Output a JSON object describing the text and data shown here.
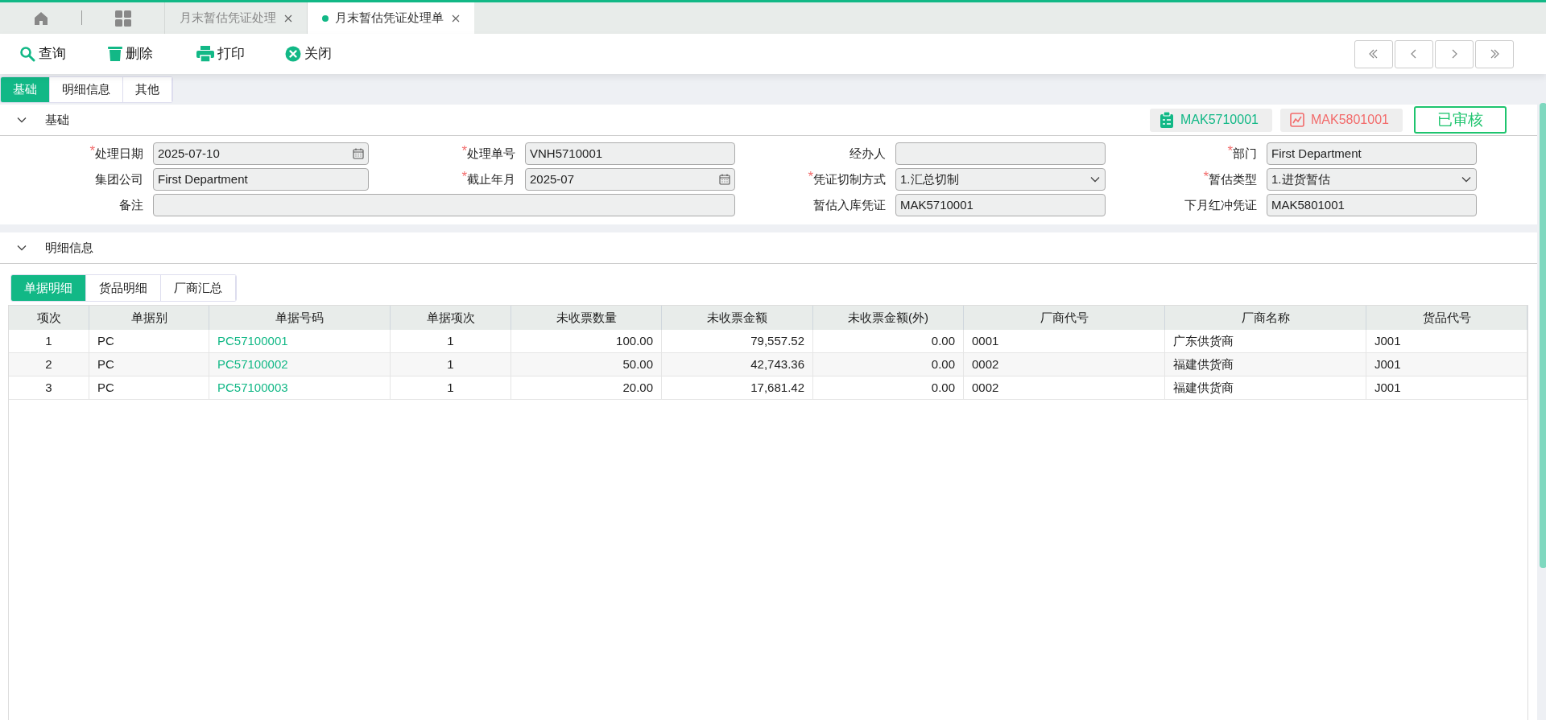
{
  "app_tabs": [
    {
      "kind": "home"
    },
    {
      "kind": "grid"
    },
    {
      "kind": "page",
      "label": "月末暂估凭证处理",
      "selected": false
    },
    {
      "kind": "page",
      "label": "月末暂估凭证处理单",
      "selected": true
    }
  ],
  "toolbar": [
    {
      "kind": "search",
      "label": "查询"
    },
    {
      "kind": "trash",
      "label": "删除"
    },
    {
      "kind": "print",
      "label": "打印"
    },
    {
      "kind": "close",
      "label": "关闭"
    }
  ],
  "pager": [
    {
      "kind": "first"
    },
    {
      "kind": "prev"
    },
    {
      "kind": "next"
    },
    {
      "kind": "last"
    }
  ],
  "section_tabs": [
    {
      "label": "基础",
      "selected": true
    },
    {
      "label": "明细信息",
      "selected": false
    },
    {
      "label": "其他",
      "selected": false
    }
  ],
  "basic_section": {
    "title": "基础",
    "expanded": true,
    "badges": [
      {
        "kind": "clipboard",
        "label": "MAK5710001"
      },
      {
        "kind": "chart",
        "label": "MAK5801001"
      }
    ],
    "status": "已审核",
    "fields": [
      {
        "label": "处理日期",
        "required_mark": "*",
        "kind": "date",
        "value": "2025-07-10"
      },
      {
        "label": "处理单号",
        "required_mark": "*",
        "kind": "text",
        "value": "VNH5710001"
      },
      {
        "label": "经办人",
        "kind": "text"
      },
      {
        "label": "部门",
        "required_mark": "*",
        "kind": "text",
        "value": "First Department"
      },
      {
        "label": "集团公司",
        "kind": "text",
        "value": "First Department"
      },
      {
        "label": "截止年月",
        "required_mark": "*",
        "kind": "date",
        "value": "2025-07"
      },
      {
        "label": "凭证切制方式",
        "required_mark": "*",
        "kind": "select",
        "value": "1.汇总切制"
      },
      {
        "label": "暂估类型",
        "required_mark": "*",
        "kind": "select",
        "value": "1.进货暂估"
      },
      {
        "label": "备注",
        "kind": "wide"
      },
      {
        "label": "暂估入库凭证",
        "kind": "text",
        "value": "MAK5710001"
      },
      {
        "label": "下月红冲凭证",
        "kind": "text",
        "value": "MAK5801001"
      }
    ]
  },
  "detail_section": {
    "title": "明细信息",
    "expanded": true,
    "sub_tabs": [
      {
        "label": "单据明细",
        "selected": true
      },
      {
        "label": "货品明细",
        "selected": false
      },
      {
        "label": "厂商汇总",
        "selected": false
      }
    ],
    "table": {
      "columns": [
        {
          "label": "项次",
          "kind": "index"
        },
        {
          "label": "单据别",
          "kind": "text"
        },
        {
          "label": "单据号码",
          "kind": "link"
        },
        {
          "label": "单据项次",
          "kind": "index"
        },
        {
          "label": "未收票数量",
          "kind": "number"
        },
        {
          "label": "未收票金额",
          "kind": "number"
        },
        {
          "label": "未收票金额(外)",
          "kind": "number"
        },
        {
          "label": "厂商代号",
          "kind": "text"
        },
        {
          "label": "厂商名称",
          "kind": "text"
        },
        {
          "label": "货品代号",
          "kind": "text"
        }
      ],
      "rows": [
        [
          "1",
          "PC",
          "PC57100001",
          "1",
          "100.00",
          "79,557.52",
          "0.00",
          "0001",
          "广东供货商",
          "J001"
        ],
        [
          "2",
          "PC",
          "PC57100002",
          "1",
          "50.00",
          "42,743.36",
          "0.00",
          "0002",
          "福建供货商",
          "J001"
        ],
        [
          "3",
          "PC",
          "PC57100003",
          "1",
          "20.00",
          "17,681.42",
          "0.00",
          "0002",
          "福建供货商",
          "J001"
        ]
      ]
    }
  }
}
